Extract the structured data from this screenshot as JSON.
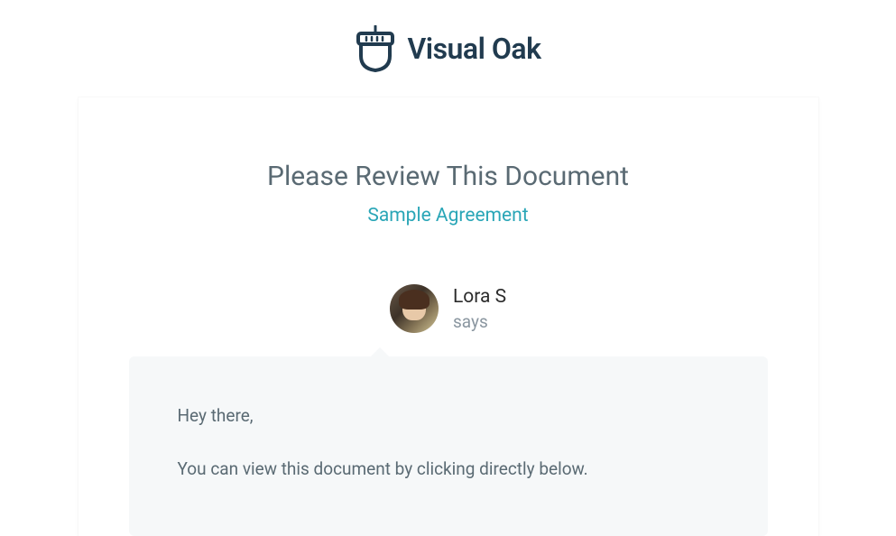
{
  "brand": {
    "name": "Visual Oak",
    "logo_color": "#213b4f"
  },
  "heading": "Please Review This Document",
  "document_title": "Sample Agreement",
  "sender": {
    "name": "Lora S",
    "says_label": "says"
  },
  "message": {
    "greeting": "Hey there,",
    "body": "You can view this document by clicking directly below."
  }
}
